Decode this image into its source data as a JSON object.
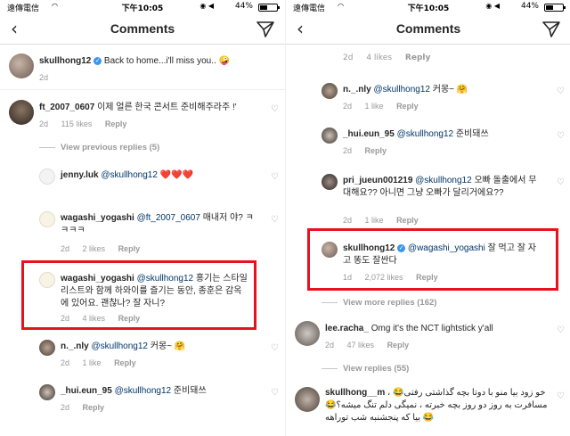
{
  "statusbar": {
    "carrier": "遠傳電信",
    "time": "下午10:05",
    "battery": "44%"
  },
  "nav": {
    "title": "Comments"
  },
  "left": {
    "caption": {
      "user": "skullhong12",
      "text": "Back to home...i'll miss you..",
      "emoji": "🤪",
      "time": "2d"
    },
    "c1": {
      "user": "ft_2007_0607",
      "text": "이제 얼른 한국 콘서트 준비해주라주 !'",
      "time": "2d",
      "likes": "115 likes",
      "reply": "Reply"
    },
    "view_prev": "View previous replies (5)",
    "r1": {
      "user": "jenny.luk",
      "mention": "@skullhong12",
      "text": "❤️❤️❤️"
    },
    "r2": {
      "user": "wagashi_yogashi",
      "mention": "@ft_2007_0607",
      "text": "매내저 야? ㅋㅋㅋㅋ",
      "time": "2d",
      "likes": "2 likes",
      "reply": "Reply"
    },
    "r3": {
      "user": "wagashi_yogashi",
      "mention": "@skullhong12",
      "text": "홍기는 스타일리스트와 함께 하와이를 즐기는 동안, 종훈은 감옥에 있어요. 괜찮나? 잘 자니?",
      "time": "2d",
      "likes": "4 likes",
      "reply": "Reply"
    },
    "r4": {
      "user": "n._.nly",
      "mention": "@skullhong12",
      "text": "커몽~",
      "emoji": "🤗",
      "time": "2d",
      "likes": "1 like",
      "reply": "Reply"
    },
    "r5": {
      "user": "_hui.eun_95",
      "mention": "@skullhong12",
      "text": "준비돼쓰",
      "time": "2d",
      "reply": "Reply"
    }
  },
  "right": {
    "top": {
      "time": "2d",
      "likes": "4 likes",
      "reply": "Reply"
    },
    "r1": {
      "user": "n._.nly",
      "mention": "@skullhong12",
      "text": "커몽~",
      "emoji": "🤗",
      "time": "2d",
      "likes": "1 like",
      "reply": "Reply"
    },
    "r2": {
      "user": "_hui.eun_95",
      "mention": "@skullhong12",
      "text": "준비돼쓰",
      "time": "2d",
      "reply": "Reply"
    },
    "r3": {
      "user": "pri_jueun001219",
      "mention": "@skullhong12",
      "text": "오빠 돌출에서 무대해요?? 아니면 그냥 오빠가 달리거에요??",
      "time": "2d",
      "likes": "1 like",
      "reply": "Reply"
    },
    "r4": {
      "user": "skullhong12",
      "mention": "@wagashi_yogashi",
      "text": "잘 먹고 잘 자고 똥도 잘싼다",
      "time": "1d",
      "likes": "2,072 likes",
      "reply": "Reply"
    },
    "view_more": "View more replies (162)",
    "c2": {
      "user": "lee.racha_",
      "text": "Omg it's the NCT lightstick y'all",
      "time": "2d",
      "likes": "47 likes",
      "reply": "Reply"
    },
    "view_replies": "View replies (55)",
    "c3": {
      "user": "skullhong__m",
      "text": "خو زود بیا منو با دوتا بچه گذاشتی رفتی😂 ، مسافرت به روز دو روز بچه خبرته ، نمیگی دلم تنگ میشه؟😂😂 بیا که پنجشنبه شب توراهه",
      "emoji": "😂"
    }
  },
  "colors": {
    "highlight": "#e8121f",
    "verified": "#3897f0",
    "mention": "#003569"
  }
}
